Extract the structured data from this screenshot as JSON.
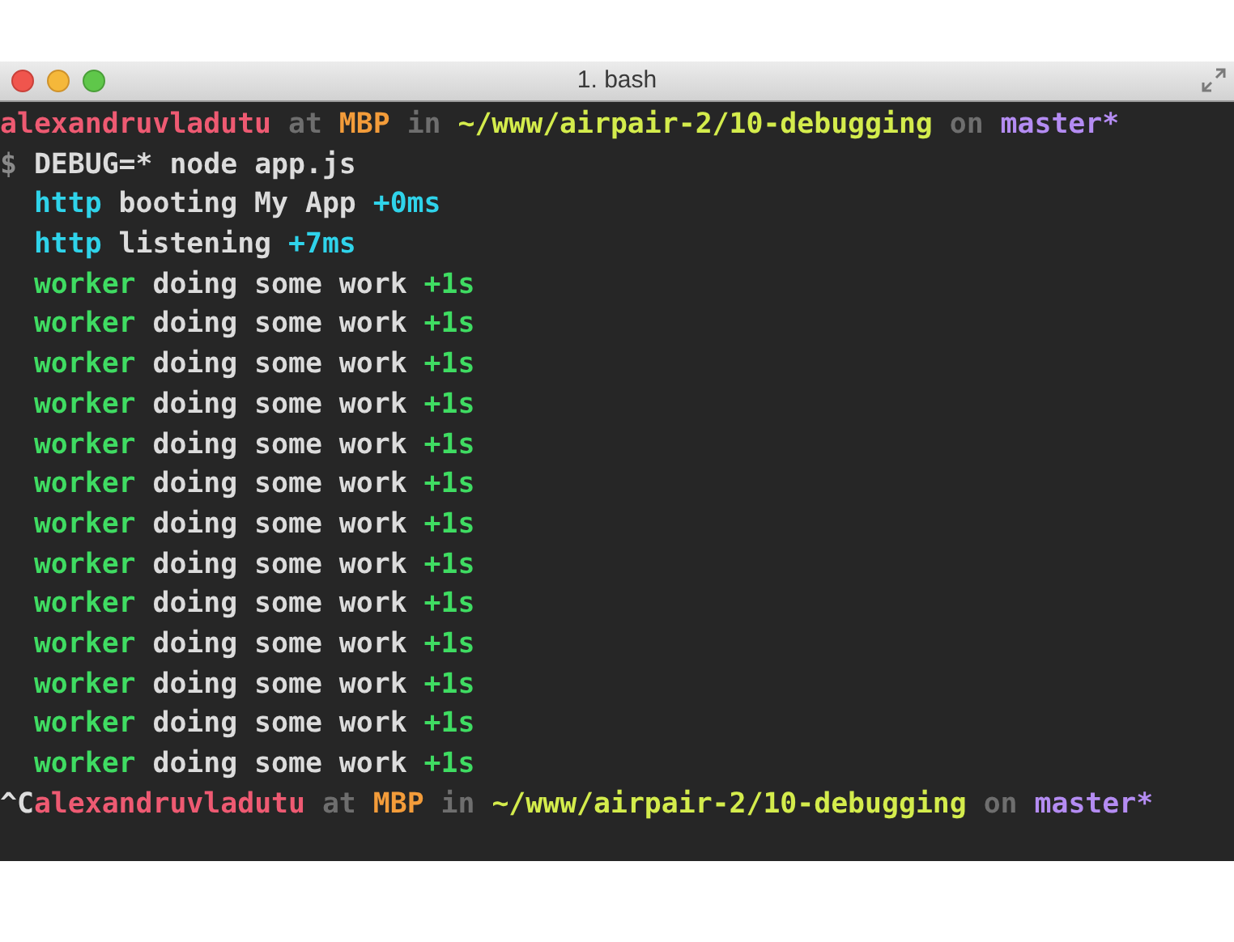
{
  "window": {
    "title": "1. bash"
  },
  "terminal": {
    "lines": [
      [
        {
          "text": "alexandruvladutu",
          "color": "#ee5a72"
        },
        {
          "text": " at ",
          "color": "#6e6e6e"
        },
        {
          "text": "MBP",
          "color": "#f39c3a"
        },
        {
          "text": " in ",
          "color": "#6e6e6e"
        },
        {
          "text": "~/www/airpair-2/10-debugging",
          "color": "#d4ec4c"
        },
        {
          "text": " on ",
          "color": "#6e6e6e"
        },
        {
          "text": "master*",
          "color": "#b48cf2"
        }
      ],
      [
        {
          "text": "$ ",
          "color": "#8a8a8a"
        },
        {
          "text": "DEBUG=* node app.js",
          "color": "#dcdcdc"
        }
      ],
      [
        {
          "text": "  http",
          "color": "#2fd3ea"
        },
        {
          "text": " booting My App ",
          "color": "#dcdcdc"
        },
        {
          "text": "+0ms",
          "color": "#2fd3ea"
        }
      ],
      [
        {
          "text": "  http",
          "color": "#2fd3ea"
        },
        {
          "text": " listening ",
          "color": "#dcdcdc"
        },
        {
          "text": "+7ms",
          "color": "#2fd3ea"
        }
      ],
      [
        {
          "text": "  worker",
          "color": "#3fdc62"
        },
        {
          "text": " doing some work ",
          "color": "#dcdcdc"
        },
        {
          "text": "+1s",
          "color": "#3fdc62"
        }
      ],
      [
        {
          "text": "  worker",
          "color": "#3fdc62"
        },
        {
          "text": " doing some work ",
          "color": "#dcdcdc"
        },
        {
          "text": "+1s",
          "color": "#3fdc62"
        }
      ],
      [
        {
          "text": "  worker",
          "color": "#3fdc62"
        },
        {
          "text": " doing some work ",
          "color": "#dcdcdc"
        },
        {
          "text": "+1s",
          "color": "#3fdc62"
        }
      ],
      [
        {
          "text": "  worker",
          "color": "#3fdc62"
        },
        {
          "text": " doing some work ",
          "color": "#dcdcdc"
        },
        {
          "text": "+1s",
          "color": "#3fdc62"
        }
      ],
      [
        {
          "text": "  worker",
          "color": "#3fdc62"
        },
        {
          "text": " doing some work ",
          "color": "#dcdcdc"
        },
        {
          "text": "+1s",
          "color": "#3fdc62"
        }
      ],
      [
        {
          "text": "  worker",
          "color": "#3fdc62"
        },
        {
          "text": " doing some work ",
          "color": "#dcdcdc"
        },
        {
          "text": "+1s",
          "color": "#3fdc62"
        }
      ],
      [
        {
          "text": "  worker",
          "color": "#3fdc62"
        },
        {
          "text": " doing some work ",
          "color": "#dcdcdc"
        },
        {
          "text": "+1s",
          "color": "#3fdc62"
        }
      ],
      [
        {
          "text": "  worker",
          "color": "#3fdc62"
        },
        {
          "text": " doing some work ",
          "color": "#dcdcdc"
        },
        {
          "text": "+1s",
          "color": "#3fdc62"
        }
      ],
      [
        {
          "text": "  worker",
          "color": "#3fdc62"
        },
        {
          "text": " doing some work ",
          "color": "#dcdcdc"
        },
        {
          "text": "+1s",
          "color": "#3fdc62"
        }
      ],
      [
        {
          "text": "  worker",
          "color": "#3fdc62"
        },
        {
          "text": " doing some work ",
          "color": "#dcdcdc"
        },
        {
          "text": "+1s",
          "color": "#3fdc62"
        }
      ],
      [
        {
          "text": "  worker",
          "color": "#3fdc62"
        },
        {
          "text": " doing some work ",
          "color": "#dcdcdc"
        },
        {
          "text": "+1s",
          "color": "#3fdc62"
        }
      ],
      [
        {
          "text": "  worker",
          "color": "#3fdc62"
        },
        {
          "text": " doing some work ",
          "color": "#dcdcdc"
        },
        {
          "text": "+1s",
          "color": "#3fdc62"
        }
      ],
      [
        {
          "text": "  worker",
          "color": "#3fdc62"
        },
        {
          "text": " doing some work ",
          "color": "#dcdcdc"
        },
        {
          "text": "+1s",
          "color": "#3fdc62"
        }
      ],
      [
        {
          "text": "^C",
          "color": "#dcdcdc"
        },
        {
          "text": "alexandruvladutu",
          "color": "#ee5a72"
        },
        {
          "text": " at ",
          "color": "#6e6e6e"
        },
        {
          "text": "MBP",
          "color": "#f39c3a"
        },
        {
          "text": " in ",
          "color": "#6e6e6e"
        },
        {
          "text": "~/www/airpair-2/10-debugging",
          "color": "#d4ec4c"
        },
        {
          "text": " on ",
          "color": "#6e6e6e"
        },
        {
          "text": "master*",
          "color": "#b48cf2"
        }
      ]
    ]
  }
}
